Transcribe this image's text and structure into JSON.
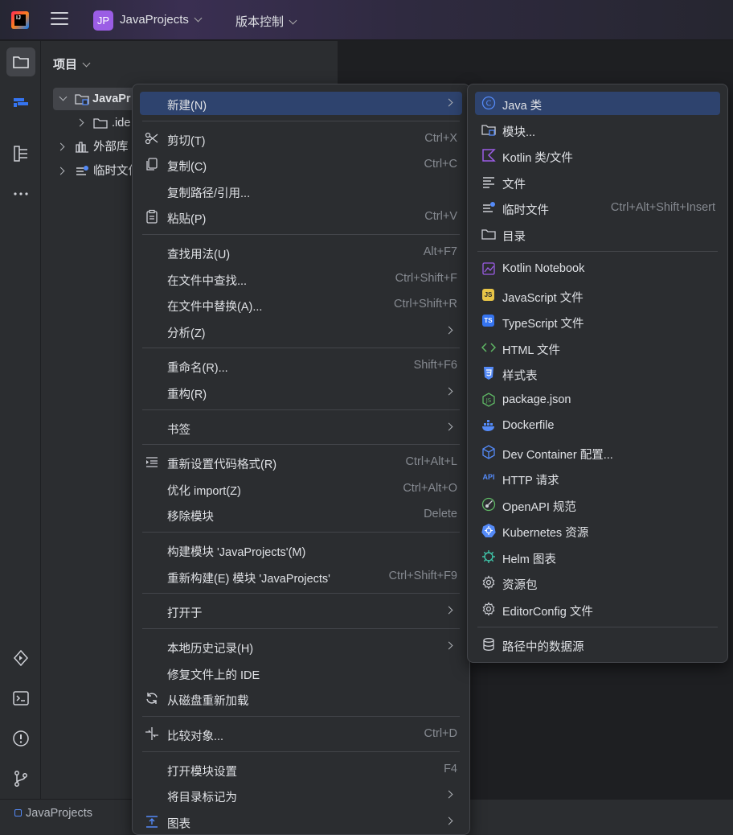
{
  "titlebar": {
    "project_badge": "JP",
    "project_name": "JavaProjects",
    "vcs_label": "版本控制"
  },
  "project_panel": {
    "title": "项目",
    "tree": [
      {
        "label": "JavaPr",
        "icon": "module-folder-icon",
        "expanded": true,
        "selected": true
      },
      {
        "label": ".ide",
        "icon": "folder-icon",
        "expanded": false
      },
      {
        "label": "外部库",
        "icon": "library-icon",
        "expanded": false
      },
      {
        "label": "临时文件",
        "icon": "scratch-icon",
        "expanded": false
      }
    ]
  },
  "status_bar": {
    "breadcrumb": "JavaProjects"
  },
  "context_menu": {
    "items": [
      {
        "label": "新建(N)",
        "shortcut": "",
        "submenu": true,
        "highlighted": true
      },
      {
        "label": "剪切(T)",
        "shortcut": "Ctrl+X",
        "icon": "scissors-icon"
      },
      {
        "label": "复制(C)",
        "shortcut": "Ctrl+C",
        "icon": "copy-icon"
      },
      {
        "label": "复制路径/引用...",
        "shortcut": ""
      },
      {
        "label": "粘贴(P)",
        "shortcut": "Ctrl+V",
        "icon": "paste-icon"
      },
      {
        "label": "查找用法(U)",
        "shortcut": "Alt+F7"
      },
      {
        "label": "在文件中查找...",
        "shortcut": "Ctrl+Shift+F"
      },
      {
        "label": "在文件中替换(A)...",
        "shortcut": "Ctrl+Shift+R"
      },
      {
        "label": "分析(Z)",
        "shortcut": "",
        "submenu": true
      },
      {
        "label": "重命名(R)...",
        "shortcut": "Shift+F6"
      },
      {
        "label": "重构(R)",
        "shortcut": "",
        "submenu": true
      },
      {
        "label": "书签",
        "shortcut": "",
        "submenu": true
      },
      {
        "label": "重新设置代码格式(R)",
        "shortcut": "Ctrl+Alt+L",
        "icon": "reformat-icon"
      },
      {
        "label": "优化 import(Z)",
        "shortcut": "Ctrl+Alt+O"
      },
      {
        "label": "移除模块",
        "shortcut": "Delete"
      },
      {
        "label": "构建模块 'JavaProjects'(M)",
        "shortcut": ""
      },
      {
        "label": "重新构建(E) 模块 'JavaProjects'",
        "shortcut": "Ctrl+Shift+F9"
      },
      {
        "label": "打开于",
        "shortcut": "",
        "submenu": true
      },
      {
        "label": "本地历史记录(H)",
        "shortcut": "",
        "submenu": true
      },
      {
        "label": "修复文件上的 IDE",
        "shortcut": ""
      },
      {
        "label": "从磁盘重新加载",
        "shortcut": "",
        "icon": "reload-icon"
      },
      {
        "label": "比较对象...",
        "shortcut": "Ctrl+D",
        "icon": "compare-icon"
      },
      {
        "label": "打开模块设置",
        "shortcut": "F4"
      },
      {
        "label": "将目录标记为",
        "shortcut": "",
        "submenu": true
      },
      {
        "label": "图表",
        "shortcut": "",
        "submenu": true,
        "icon": "diagram-icon"
      }
    ]
  },
  "new_submenu": {
    "items": [
      {
        "label": "Java 类",
        "shortcut": "",
        "icon": "java-class-icon",
        "highlighted": true
      },
      {
        "label": "模块...",
        "shortcut": "",
        "icon": "module-icon"
      },
      {
        "label": "Kotlin 类/文件",
        "shortcut": "",
        "icon": "kotlin-icon"
      },
      {
        "label": "文件",
        "shortcut": "",
        "icon": "text-file-icon"
      },
      {
        "label": "临时文件",
        "shortcut": "Ctrl+Alt+Shift+Insert",
        "icon": "scratch-file-icon"
      },
      {
        "label": "目录",
        "shortcut": "",
        "icon": "directory-icon"
      },
      {
        "label": "Kotlin Notebook",
        "shortcut": "",
        "icon": "notebook-icon"
      },
      {
        "label": "JavaScript 文件",
        "shortcut": "",
        "icon": "javascript-icon",
        "badge": "JS"
      },
      {
        "label": "TypeScript 文件",
        "shortcut": "",
        "icon": "typescript-icon",
        "badge": "TS"
      },
      {
        "label": "HTML 文件",
        "shortcut": "",
        "icon": "html-icon"
      },
      {
        "label": "样式表",
        "shortcut": "",
        "icon": "css-icon"
      },
      {
        "label": "package.json",
        "shortcut": "",
        "icon": "nodejs-icon"
      },
      {
        "label": "Dockerfile",
        "shortcut": "",
        "icon": "docker-icon"
      },
      {
        "label": "Dev Container 配置...",
        "shortcut": "",
        "icon": "cube-icon"
      },
      {
        "label": "HTTP 请求",
        "shortcut": "",
        "icon": "api-icon",
        "badge": "API"
      },
      {
        "label": "OpenAPI 规范",
        "shortcut": "",
        "icon": "openapi-icon"
      },
      {
        "label": "Kubernetes 资源",
        "shortcut": "",
        "icon": "kubernetes-icon"
      },
      {
        "label": "Helm 图表",
        "shortcut": "",
        "icon": "helm-icon"
      },
      {
        "label": "资源包",
        "shortcut": "",
        "icon": "gear-icon"
      },
      {
        "label": "EditorConfig 文件",
        "shortcut": "",
        "icon": "editorconfig-icon"
      },
      {
        "label": "路径中的数据源",
        "shortcut": "",
        "icon": "database-icon"
      }
    ]
  },
  "colors": {
    "accent": "#2e436e",
    "background": "#2b2d30",
    "text": "#dfe1e5",
    "muted": "#868a91"
  }
}
